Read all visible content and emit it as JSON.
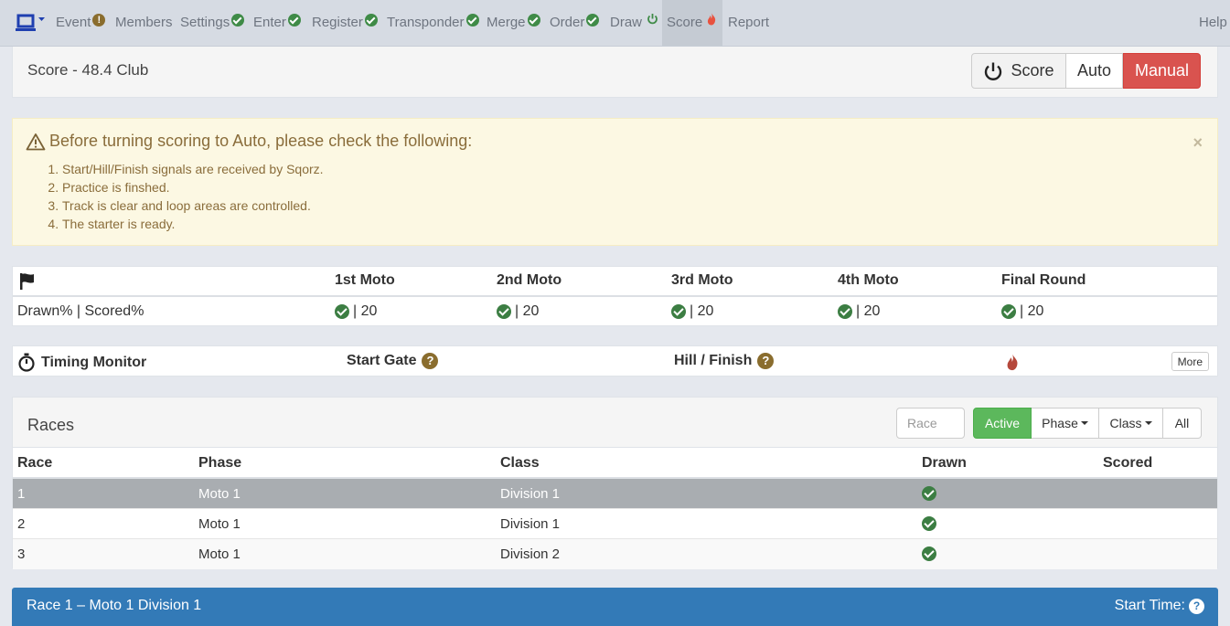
{
  "nav": {
    "items": [
      {
        "label": "Event",
        "status": "warn",
        "status_glyph": "!"
      },
      {
        "label": "Members",
        "status": "none"
      },
      {
        "label": "Settings",
        "status": "ok"
      },
      {
        "label": "Enter",
        "status": "ok"
      },
      {
        "label": "Register",
        "status": "ok"
      },
      {
        "label": "Transponder",
        "status": "ok"
      },
      {
        "label": "Merge",
        "status": "ok"
      },
      {
        "label": "Order",
        "status": "ok"
      },
      {
        "label": "Draw",
        "status": "power"
      },
      {
        "label": "Score",
        "status": "fire",
        "active": true
      },
      {
        "label": "Report",
        "status": "none"
      }
    ],
    "help": "Help",
    "icons": {
      "logo": "laptop-icon",
      "ok": "check-circle-icon",
      "warn": "exclamation-circle-icon",
      "power": "power-icon",
      "fire": "fire-icon"
    }
  },
  "score_header": {
    "title": "Score - 48.4 Club",
    "buttons": {
      "score": "Score",
      "auto": "Auto",
      "manual": "Manual"
    }
  },
  "alert": {
    "title": "Before turning scoring to Auto, please check the following:",
    "items": [
      "Start/Hill/Finish signals are received by Sqorz.",
      "Practice is finshed.",
      "Track is clear and loop areas are controlled.",
      "The starter is ready."
    ],
    "close": "×"
  },
  "motos": {
    "row_label": "Drawn% | Scored%",
    "columns": [
      {
        "label": "1st Moto",
        "value": "| 20"
      },
      {
        "label": "2nd Moto",
        "value": "| 20"
      },
      {
        "label": "3rd Moto",
        "value": "| 20"
      },
      {
        "label": "4th Moto",
        "value": "| 20"
      },
      {
        "label": "Final Round",
        "value": "| 20"
      }
    ]
  },
  "timing": {
    "title": "Timing Monitor",
    "start_gate": "Start Gate",
    "hill_finish": "Hill / Finish",
    "help_glyph": "?",
    "more": "More"
  },
  "races": {
    "title": "Races",
    "race_placeholder": "Race",
    "filters": {
      "active": "Active",
      "phase": "Phase",
      "class": "Class",
      "all": "All"
    },
    "columns": [
      "Race",
      "Phase",
      "Class",
      "Drawn",
      "Scored"
    ],
    "rows": [
      {
        "race": "1",
        "phase": "Moto 1",
        "class": "Division 1",
        "drawn": true,
        "scored": ""
      },
      {
        "race": "2",
        "phase": "Moto 1",
        "class": "Division 1",
        "drawn": true,
        "scored": ""
      },
      {
        "race": "3",
        "phase": "Moto 1",
        "class": "Division 2",
        "drawn": true,
        "scored": ""
      }
    ]
  },
  "race_banner": {
    "title": "Race 1 – Moto 1 Division 1",
    "start_time": "Start Time:",
    "help_glyph": "?"
  },
  "colors": {
    "nav_bg": "#d6dbe3",
    "manual": "#d9534f",
    "active_filter": "#5cb85c",
    "alert_bg": "#fcf8e3",
    "alert_text": "#8a6d3b",
    "check": "#3c7e43",
    "banner": "#337ab7"
  }
}
